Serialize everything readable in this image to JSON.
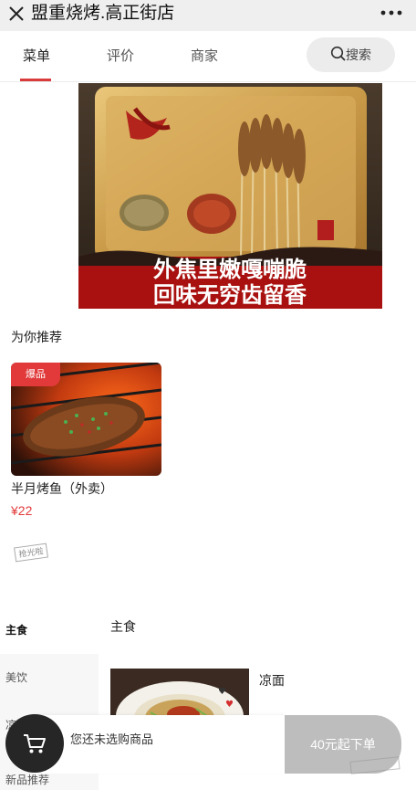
{
  "topbar": {
    "title": "盟重烧烤.高正街店",
    "close_icon": "close-icon",
    "more_icon": "more-dots-icon"
  },
  "tabs": [
    {
      "label": "菜单",
      "active": true
    },
    {
      "label": "评价",
      "active": false
    },
    {
      "label": "商家",
      "active": false
    }
  ],
  "search": {
    "label": "搜索",
    "icon": "search-icon"
  },
  "banner": {
    "line1": "外焦里嫩嘎嘣脆",
    "line2": "回味无穷齿留香",
    "seal_text": "盟重"
  },
  "recommend": {
    "heading": "为你推荐",
    "item": {
      "badge": "爆品",
      "name": "半月烤鱼（外卖）",
      "price": "¥22",
      "sold_out_label": "抢光啦"
    }
  },
  "categories": [
    {
      "label": "主食",
      "active": true
    },
    {
      "label": "美饮",
      "active": false
    },
    {
      "label": "凉",
      "active": false
    },
    {
      "label": "新品推荐",
      "active": false
    }
  ],
  "menu": {
    "section_title": "主食",
    "items": [
      {
        "name": "凉面"
      }
    ]
  },
  "cart": {
    "empty_text": "您还未选购商品",
    "order_button": "40元起下单",
    "icon": "cart-icon"
  },
  "colors": {
    "accent_red": "#e23a3a",
    "tab_underline": "#d93a3a",
    "cart_dark": "#262626",
    "order_disabled": "#bdbdbd"
  }
}
